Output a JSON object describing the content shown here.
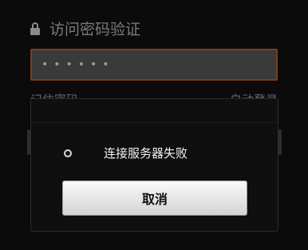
{
  "background": {
    "title": "访问密码验证",
    "lock_icon": "lock-icon",
    "password_field": {
      "value": "••••••"
    },
    "row": {
      "left": "记住密码",
      "right": "自动登录"
    }
  },
  "dialog": {
    "message": "连接服务器失败",
    "status_icon": "spinner-icon",
    "cancel_label": "取消"
  },
  "colors": {
    "field_border": "#7a3d1e",
    "background": "#0b0b0b"
  }
}
